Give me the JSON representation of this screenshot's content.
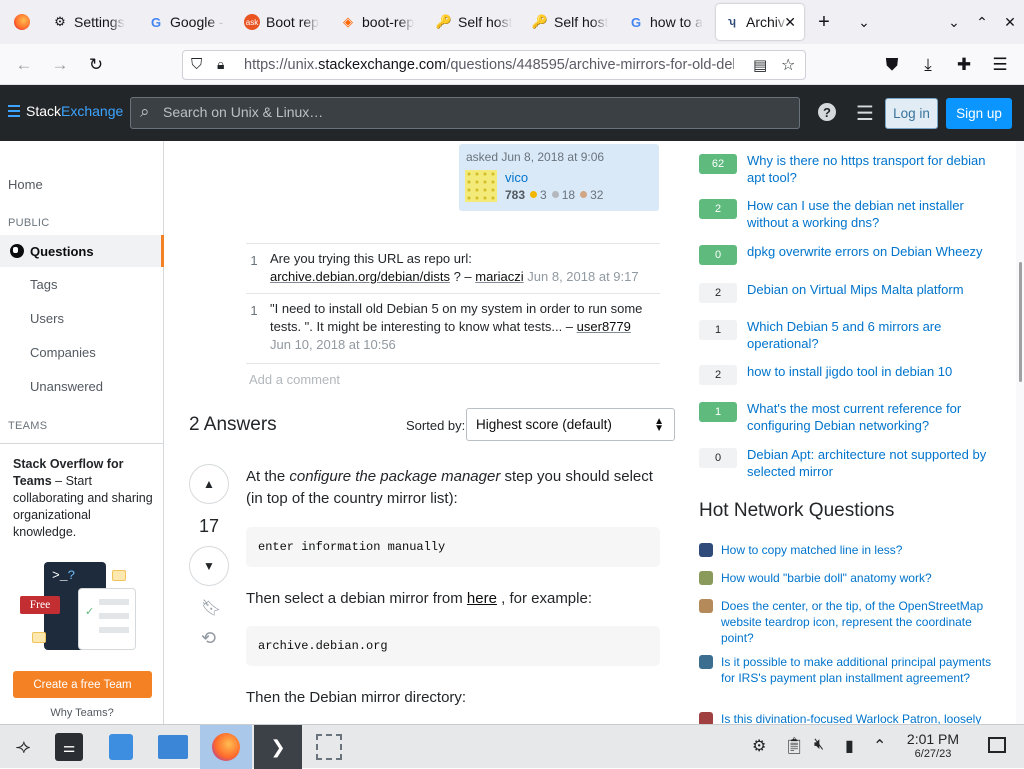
{
  "browser": {
    "tabs": [
      {
        "label": "Settings",
        "icon": "gear-icon"
      },
      {
        "label": "Google -",
        "icon": "google-icon"
      },
      {
        "label": "Boot rep",
        "icon": "askubuntu-icon"
      },
      {
        "label": "boot-rep",
        "icon": "sourceforge-icon"
      },
      {
        "label": "Self host",
        "icon": "key-icon"
      },
      {
        "label": "Self host",
        "icon": "key-icon"
      },
      {
        "label": "how to a",
        "icon": "google-icon"
      },
      {
        "label": "Archiv",
        "icon": "unix-se-icon",
        "active": true
      }
    ],
    "url_prefix": "https://unix.",
    "url_domain": "stackexchange.com",
    "url_path": "/questions/448595/archive-mirrors-for-old-debi"
  },
  "se_header": {
    "logo_part1": "Stack",
    "logo_part2": "Exchange",
    "search_placeholder": "Search on Unix & Linux…",
    "login_label": "Log in",
    "signup_label": "Sign up"
  },
  "left_nav": {
    "home": "Home",
    "public_label": "PUBLIC",
    "questions": "Questions",
    "tags": "Tags",
    "users": "Users",
    "companies": "Companies",
    "unanswered": "Unanswered",
    "teams_label": "TEAMS",
    "teams_title": "Stack Overflow for Teams",
    "teams_desc": " – Start collaborating and sharing organizational knowledge.",
    "free_badge": "Free",
    "create_team": "Create a free Team",
    "why_teams": "Why Teams?"
  },
  "asked": {
    "when": "asked Jun 8, 2018 at 9:06",
    "user": "vico",
    "rep": "783",
    "gold": "3",
    "silver": "18",
    "bronze": "32"
  },
  "comments": [
    {
      "score": "1",
      "text_before": "Are you trying this URL as repo url: ",
      "link": "archive.debian.org/debian/dists",
      "text_after": " ? – ",
      "user": "mariaczi",
      "date": "Jun 8, 2018 at 9:17"
    },
    {
      "score": "1",
      "text_before": "\"I need to install old Debian 5 on my system in order to run some tests. \". It might be interesting to know what tests... – ",
      "link": "",
      "text_after": "",
      "user": "user8779",
      "date": "Jun 10, 2018 at 10:56"
    }
  ],
  "add_comment": "Add a comment",
  "answers": {
    "count_label": "2 Answers",
    "sorted_by": "Sorted by:",
    "sort_value": "Highest score (default)",
    "votes": "17",
    "p1_a": "At the ",
    "p1_em": "configure the package manager",
    "p1_b": " step you should select (in top of the country mirror list):",
    "code1": "enter information manually",
    "p2_a": "Then select a debian mirror from ",
    "p2_link": "here",
    "p2_b": " , for example:",
    "code2": "archive.debian.org",
    "p3": "Then the Debian mirror directory:"
  },
  "related": [
    {
      "score": "62",
      "title": "Why is there no https transport for debian apt tool?",
      "answered": true
    },
    {
      "score": "2",
      "title": "How can I use the debian net installer without a working dns?",
      "answered": true
    },
    {
      "score": "0",
      "title": "dpkg overwrite errors on Debian Wheezy",
      "answered": true
    },
    {
      "score": "2",
      "title": "Debian on Virtual Mips Malta platform",
      "answered": false
    },
    {
      "score": "1",
      "title": "Which Debian 5 and 6 mirrors are operational?",
      "answered": false
    },
    {
      "score": "2",
      "title": "how to install jigdo tool in debian 10",
      "answered": false
    },
    {
      "score": "1",
      "title": "What's the most current reference for configuring Debian networking?",
      "answered": true
    },
    {
      "score": "0",
      "title": "Debian Apt: architecture not supported by selected mirror",
      "answered": false
    }
  ],
  "hot_network": {
    "title": "Hot Network Questions",
    "items": [
      {
        "title": "How to copy matched line in less?",
        "color": "#2f4b7a"
      },
      {
        "title": "How would \"barbie doll\" anatomy work?",
        "color": "#8a9a5b"
      },
      {
        "title": "Does the center, or the tip, of the OpenStreetMap website teardrop icon, represent the coordinate point?",
        "color": "#b58a5a"
      },
      {
        "title": "Is it possible to make additional principal payments for IRS's payment plan installment agreement?",
        "color": "#3c6e8f"
      },
      {
        "title": "Is this divination-focused Warlock Patron, loosely",
        "color": "#a04040"
      }
    ]
  },
  "taskbar": {
    "time": "2:01 PM",
    "date": "6/27/23"
  }
}
